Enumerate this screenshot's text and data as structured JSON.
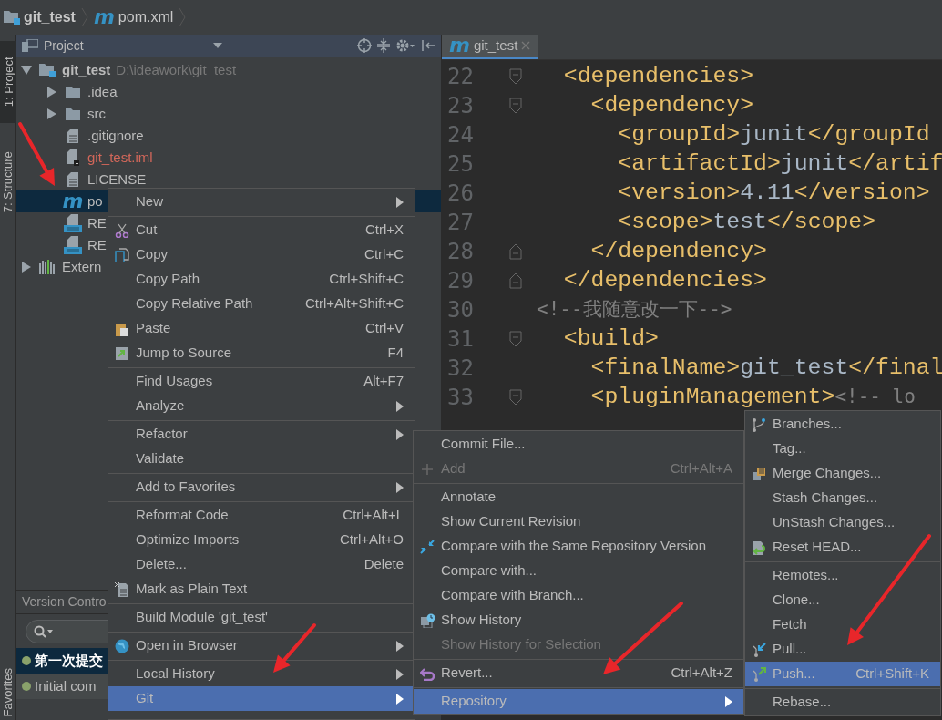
{
  "breadcrumb": [
    {
      "label": "git_test",
      "kind": "project"
    },
    {
      "icon_glyph": "m",
      "label": "pom.xml",
      "kind": "maven"
    }
  ],
  "tool_strip": [
    {
      "label": "1: Project",
      "selected": true
    },
    {
      "label": "7: Structure",
      "selected": false
    },
    {
      "label": "Favorites",
      "selected": false
    }
  ],
  "project_panel": {
    "title": "Project",
    "tree": [
      {
        "label": "git_test",
        "path": "D:\\ideawork\\git_test",
        "kind": "project",
        "expanded": true,
        "selected": false,
        "color": "#bbbbbb",
        "children": [
          {
            "label": ".idea",
            "kind": "folder",
            "expanded": false,
            "selected": false,
            "color": "#bbbbbb"
          },
          {
            "label": "src",
            "kind": "folder",
            "expanded": false,
            "selected": false,
            "color": "#bbbbbb"
          },
          {
            "label": ".gitignore",
            "kind": "file",
            "selected": false,
            "color": "#bbbbbb"
          },
          {
            "label": "git_test.iml",
            "kind": "module",
            "selected": false,
            "color": "#d1675a"
          },
          {
            "label": "LICENSE",
            "kind": "file",
            "selected": false,
            "color": "#bbbbbb"
          },
          {
            "label": "po",
            "kind": "maven",
            "icon_glyph": "m",
            "selected": true,
            "color": "#bbbbbb"
          },
          {
            "label": "RE",
            "kind": "markdown",
            "selected": false,
            "color": "#bbbbbb"
          },
          {
            "label": "RE",
            "kind": "markdown",
            "selected": false,
            "color": "#bbbbbb"
          }
        ]
      },
      {
        "label": "Extern",
        "kind": "library",
        "expanded": false,
        "selected": false,
        "color": "#bbbbbb"
      }
    ]
  },
  "version_control": {
    "title": "Version Contro",
    "commits": [
      {
        "message": "第一次提交",
        "selected": true
      },
      {
        "message": "Initial com",
        "selected": false
      }
    ]
  },
  "editor": {
    "tab": {
      "icon_glyph": "m",
      "label": "git_test"
    },
    "lines": [
      {
        "number": "22",
        "kind": "fold-start",
        "segments": [
          {
            "kind": "tag",
            "text": "  <dependencies>"
          }
        ]
      },
      {
        "number": "23",
        "kind": "fold-start",
        "segments": [
          {
            "kind": "tag",
            "text": "    <dependency>"
          }
        ]
      },
      {
        "number": "24",
        "kind": "plain",
        "segments": [
          {
            "kind": "tag",
            "text": "      <groupId>"
          },
          {
            "kind": "text",
            "text": "junit"
          },
          {
            "kind": "tag",
            "text": "</groupId"
          }
        ]
      },
      {
        "number": "25",
        "kind": "plain",
        "segments": [
          {
            "kind": "tag",
            "text": "      <artifactId>"
          },
          {
            "kind": "text",
            "text": "junit"
          },
          {
            "kind": "tag",
            "text": "</artif"
          }
        ]
      },
      {
        "number": "26",
        "kind": "plain",
        "segments": [
          {
            "kind": "tag",
            "text": "      <version>"
          },
          {
            "kind": "text",
            "text": "4.11"
          },
          {
            "kind": "tag",
            "text": "</version>"
          }
        ]
      },
      {
        "number": "27",
        "kind": "plain",
        "segments": [
          {
            "kind": "tag",
            "text": "      <scope>"
          },
          {
            "kind": "text",
            "text": "test"
          },
          {
            "kind": "tag",
            "text": "</scope>"
          }
        ]
      },
      {
        "number": "28",
        "kind": "fold-end",
        "segments": [
          {
            "kind": "tag",
            "text": "    </dependency>"
          }
        ]
      },
      {
        "number": "29",
        "kind": "fold-end",
        "segments": [
          {
            "kind": "tag",
            "text": "  </dependencies>"
          }
        ]
      },
      {
        "number": "30",
        "kind": "plain",
        "segments": [
          {
            "kind": "comment",
            "text": "<!--我随意改一下-->"
          }
        ]
      },
      {
        "number": "31",
        "kind": "fold-start",
        "segments": [
          {
            "kind": "tag",
            "text": "  <build>"
          }
        ]
      },
      {
        "number": "32",
        "kind": "plain",
        "segments": [
          {
            "kind": "tag",
            "text": "    <finalName>"
          },
          {
            "kind": "text",
            "text": "git_test"
          },
          {
            "kind": "tag",
            "text": "</final"
          }
        ]
      },
      {
        "number": "33",
        "kind": "fold-start",
        "segments": [
          {
            "kind": "tag",
            "text": "    <pluginManagement>"
          },
          {
            "kind": "comment",
            "text": "<!-- lo"
          }
        ]
      }
    ]
  },
  "menus": [
    {
      "groups": [
        [
          {
            "label": "New",
            "submenu": true,
            "disabled": false,
            "selected": false
          }
        ],
        [
          {
            "label": "Cut",
            "shortcut": "Ctrl+X",
            "submenu": false,
            "disabled": false,
            "selected": false
          },
          {
            "label": "Copy",
            "shortcut": "Ctrl+C",
            "submenu": false,
            "disabled": false,
            "selected": false
          },
          {
            "label": "Copy Path",
            "shortcut": "Ctrl+Shift+C",
            "submenu": false,
            "disabled": false,
            "selected": false
          },
          {
            "label": "Copy Relative Path",
            "shortcut": "Ctrl+Alt+Shift+C",
            "submenu": false,
            "disabled": false,
            "selected": false
          },
          {
            "label": "Paste",
            "shortcut": "Ctrl+V",
            "submenu": false,
            "disabled": false,
            "selected": false
          },
          {
            "label": "Jump to Source",
            "shortcut": "F4",
            "submenu": false,
            "disabled": false,
            "selected": false
          }
        ],
        [
          {
            "label": "Find Usages",
            "shortcut": "Alt+F7",
            "submenu": false,
            "disabled": false,
            "selected": false
          },
          {
            "label": "Analyze",
            "submenu": true,
            "disabled": false,
            "selected": false
          }
        ],
        [
          {
            "label": "Refactor",
            "submenu": true,
            "disabled": false,
            "selected": false
          },
          {
            "label": "Validate",
            "submenu": false,
            "disabled": false,
            "selected": false
          }
        ],
        [
          {
            "label": "Add to Favorites",
            "submenu": true,
            "disabled": false,
            "selected": false
          }
        ],
        [
          {
            "label": "Reformat Code",
            "shortcut": "Ctrl+Alt+L",
            "submenu": false,
            "disabled": false,
            "selected": false
          },
          {
            "label": "Optimize Imports",
            "shortcut": "Ctrl+Alt+O",
            "submenu": false,
            "disabled": false,
            "selected": false
          },
          {
            "label": "Delete...",
            "shortcut": "Delete",
            "submenu": false,
            "disabled": false,
            "selected": false
          },
          {
            "label": "Mark as Plain Text",
            "submenu": false,
            "disabled": false,
            "selected": false
          }
        ],
        [
          {
            "label": "Build Module 'git_test'",
            "submenu": false,
            "disabled": false,
            "selected": false
          }
        ],
        [
          {
            "label": "Open in Browser",
            "submenu": true,
            "disabled": false,
            "selected": false
          }
        ],
        [
          {
            "label": "Local History",
            "submenu": true,
            "disabled": false,
            "selected": false
          },
          {
            "label": "Git",
            "submenu": true,
            "disabled": false,
            "selected": true
          }
        ]
      ]
    },
    {
      "groups": [
        [
          {
            "label": "Commit File...",
            "submenu": false,
            "disabled": false,
            "selected": false
          },
          {
            "label": "Add",
            "shortcut": "Ctrl+Alt+A",
            "submenu": false,
            "disabled": true,
            "selected": false
          }
        ],
        [
          {
            "label": "Annotate",
            "submenu": false,
            "disabled": false,
            "selected": false
          },
          {
            "label": "Show Current Revision",
            "submenu": false,
            "disabled": false,
            "selected": false
          },
          {
            "label": "Compare with the Same Repository Version",
            "submenu": false,
            "disabled": false,
            "selected": false
          },
          {
            "label": "Compare with...",
            "submenu": false,
            "disabled": false,
            "selected": false
          },
          {
            "label": "Compare with Branch...",
            "submenu": false,
            "disabled": false,
            "selected": false
          },
          {
            "label": "Show History",
            "submenu": false,
            "disabled": false,
            "selected": false
          },
          {
            "label": "Show History for Selection",
            "submenu": false,
            "disabled": true,
            "selected": false
          }
        ],
        [
          {
            "label": "Revert...",
            "shortcut": "Ctrl+Alt+Z",
            "submenu": false,
            "disabled": false,
            "selected": false
          }
        ],
        [
          {
            "label": "Repository",
            "submenu": true,
            "disabled": false,
            "selected": true
          }
        ]
      ]
    },
    {
      "groups": [
        [
          {
            "label": "Branches...",
            "submenu": false,
            "disabled": false,
            "selected": false
          },
          {
            "label": "Tag...",
            "submenu": false,
            "disabled": false,
            "selected": false
          },
          {
            "label": "Merge Changes...",
            "submenu": false,
            "disabled": false,
            "selected": false
          },
          {
            "label": "Stash Changes...",
            "submenu": false,
            "disabled": false,
            "selected": false
          },
          {
            "label": "UnStash Changes...",
            "submenu": false,
            "disabled": false,
            "selected": false
          },
          {
            "label": "Reset HEAD...",
            "submenu": false,
            "disabled": false,
            "selected": false
          }
        ],
        [
          {
            "label": "Remotes...",
            "submenu": false,
            "disabled": false,
            "selected": false
          },
          {
            "label": "Clone...",
            "submenu": false,
            "disabled": false,
            "selected": false
          },
          {
            "label": "Fetch",
            "submenu": false,
            "disabled": false,
            "selected": false
          },
          {
            "label": "Pull...",
            "submenu": false,
            "disabled": false,
            "selected": false
          },
          {
            "label": "Push...",
            "shortcut": "Ctrl+Shift+K",
            "submenu": false,
            "disabled": false,
            "selected": true
          }
        ],
        [
          {
            "label": "Rebase...",
            "submenu": false,
            "disabled": false,
            "selected": false
          }
        ]
      ]
    }
  ]
}
